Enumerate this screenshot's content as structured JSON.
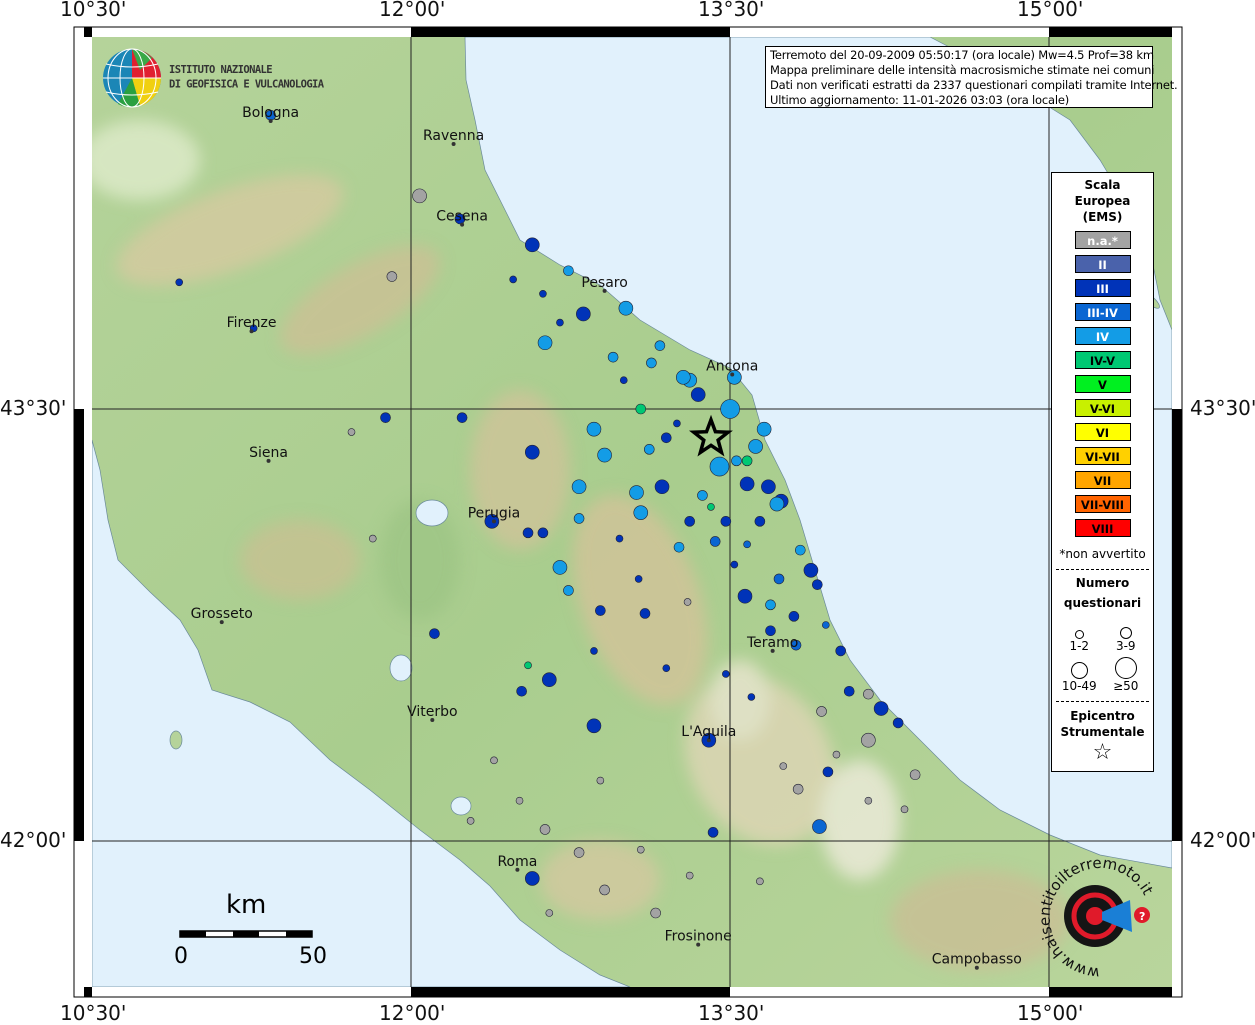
{
  "axes": {
    "lon_ticks": [
      "10°30'",
      "12°00'",
      "13°30'",
      "15°00'"
    ],
    "lat_ticks": [
      "43°30'",
      "42°00'"
    ]
  },
  "info": {
    "line1": "Terremoto del 20-09-2009 05:50:17 (ora locale) Mw=4.5 Prof=38 km",
    "line2": "Mappa preliminare delle intensità macrosismiche stimate nei comuni",
    "line3": "Dati non verificati estratti da 2337 questionari compilati tramite Internet.",
    "line4": "Ultimo aggiornamento: 11-01-2026 03:03 (ora locale)"
  },
  "logo": {
    "ingv_line1": "ISTITUTO NAZIONALE",
    "ingv_line2": "DI GEOFISICA E VULCANOLOGIA",
    "haisentito": "www.haisentitoilterremoto.it"
  },
  "legend": {
    "title": [
      "Scala",
      "Europea",
      "(EMS)"
    ],
    "items": [
      {
        "label": "n.a.*",
        "color": "#a3a3a3",
        "text": "#ffffff"
      },
      {
        "label": "II",
        "color": "#4a62ab",
        "text": "#ffffff"
      },
      {
        "label": "III",
        "color": "#0033b8",
        "text": "#ffffff"
      },
      {
        "label": "III-IV",
        "color": "#0a66d2",
        "text": "#ffffff"
      },
      {
        "label": "IV",
        "color": "#139ce6",
        "text": "#ffffff"
      },
      {
        "label": "IV-V",
        "color": "#00c873",
        "text": "#000000"
      },
      {
        "label": "V",
        "color": "#00f020",
        "text": "#000000"
      },
      {
        "label": "V-VI",
        "color": "#c8f000",
        "text": "#000000"
      },
      {
        "label": "VI",
        "color": "#ffff00",
        "text": "#000000"
      },
      {
        "label": "VI-VII",
        "color": "#ffd000",
        "text": "#000000"
      },
      {
        "label": "VII",
        "color": "#ffa500",
        "text": "#000000"
      },
      {
        "label": "VII-VIII",
        "color": "#ff6400",
        "text": "#000000"
      },
      {
        "label": "VIII",
        "color": "#ff0000",
        "text": "#000000"
      }
    ],
    "note": "*non avvertito",
    "count_title": [
      "Numero",
      "questionari"
    ],
    "count_classes": [
      "1-2",
      "3-9",
      "10-49",
      "≥50"
    ],
    "epicenter_title": [
      "Epicentro",
      "Strumentale"
    ]
  },
  "scale_bar": {
    "unit": "km",
    "start": "0",
    "end": "50"
  },
  "cities": [
    {
      "name": "Bologna",
      "lon": 11.34,
      "lat": 44.5
    },
    {
      "name": "Ravenna",
      "lon": 12.2,
      "lat": 44.42
    },
    {
      "name": "Cesena",
      "lon": 12.24,
      "lat": 44.14
    },
    {
      "name": "Pesaro",
      "lon": 12.91,
      "lat": 43.91
    },
    {
      "name": "Firenze",
      "lon": 11.25,
      "lat": 43.77
    },
    {
      "name": "Ancona",
      "lon": 13.51,
      "lat": 43.62
    },
    {
      "name": "Siena",
      "lon": 11.33,
      "lat": 43.32
    },
    {
      "name": "Perugia",
      "lon": 12.39,
      "lat": 43.11
    },
    {
      "name": "Grosseto",
      "lon": 11.11,
      "lat": 42.76
    },
    {
      "name": "Teramo",
      "lon": 13.7,
      "lat": 42.66
    },
    {
      "name": "Viterbo",
      "lon": 12.1,
      "lat": 42.42
    },
    {
      "name": "L'Aquila",
      "lon": 13.4,
      "lat": 42.35
    },
    {
      "name": "Roma",
      "lon": 12.5,
      "lat": 41.9
    },
    {
      "name": "Frosinone",
      "lon": 13.35,
      "lat": 41.64
    },
    {
      "name": "Campobasso",
      "lon": 14.66,
      "lat": 41.56
    }
  ],
  "epicenter": {
    "lon": 13.41,
    "lat": 43.4
  },
  "observations": [
    [
      13.5,
      43.5,
      "IV",
      4
    ],
    [
      13.45,
      43.3,
      "IV",
      4
    ],
    [
      13.31,
      43.6,
      "IV",
      3
    ],
    [
      13.35,
      43.55,
      "III",
      3
    ],
    [
      13.66,
      43.43,
      "IV",
      3
    ],
    [
      13.62,
      43.37,
      "IV",
      3
    ],
    [
      13.53,
      43.32,
      "IV",
      2
    ],
    [
      13.58,
      43.24,
      "III",
      3
    ],
    [
      13.68,
      43.23,
      "III",
      3
    ],
    [
      13.74,
      43.18,
      "III",
      3
    ],
    [
      13.72,
      43.17,
      "IV",
      3
    ],
    [
      13.64,
      43.11,
      "III",
      2
    ],
    [
      13.48,
      43.11,
      "III",
      2
    ],
    [
      13.31,
      43.11,
      "III",
      2
    ],
    [
      13.18,
      43.23,
      "III",
      3
    ],
    [
      13.08,
      43.14,
      "IV",
      3
    ],
    [
      13.06,
      43.21,
      "IV",
      3
    ],
    [
      12.91,
      43.34,
      "IV",
      3
    ],
    [
      12.86,
      43.43,
      "IV",
      3
    ],
    [
      12.79,
      43.23,
      "IV",
      3
    ],
    [
      12.79,
      43.12,
      "IV",
      2
    ],
    [
      12.63,
      43.73,
      "IV",
      3
    ],
    [
      12.81,
      43.83,
      "III",
      3
    ],
    [
      13.01,
      43.85,
      "IV",
      3
    ],
    [
      13.17,
      43.72,
      "IV",
      2
    ],
    [
      13.28,
      43.61,
      "IV",
      3
    ],
    [
      13.52,
      43.61,
      "IV",
      3
    ],
    [
      12.57,
      44.07,
      "III",
      3
    ],
    [
      12.74,
      43.98,
      "IV",
      2
    ],
    [
      12.23,
      44.16,
      "III",
      2
    ],
    [
      12.04,
      44.24,
      "na",
      3
    ],
    [
      11.88,
      43.47,
      "III",
      2
    ],
    [
      12.24,
      43.47,
      "III",
      2
    ],
    [
      12.57,
      43.35,
      "III",
      3
    ],
    [
      12.38,
      43.11,
      "III",
      3
    ],
    [
      12.55,
      43.07,
      "III",
      2
    ],
    [
      12.62,
      43.07,
      "III",
      2
    ],
    [
      12.7,
      42.95,
      "IV",
      3
    ],
    [
      13.1,
      42.79,
      "III",
      2
    ],
    [
      13.57,
      42.85,
      "III",
      3
    ],
    [
      13.69,
      42.82,
      "IV",
      2
    ],
    [
      13.88,
      42.94,
      "III",
      3
    ],
    [
      13.91,
      42.89,
      "III",
      2
    ],
    [
      13.73,
      42.91,
      "III-IV",
      2
    ],
    [
      13.8,
      42.78,
      "III",
      2
    ],
    [
      13.69,
      42.73,
      "III",
      2
    ],
    [
      13.81,
      42.68,
      "III-IV",
      2
    ],
    [
      14.02,
      42.66,
      "III",
      2
    ],
    [
      14.06,
      42.52,
      "III",
      2
    ],
    [
      14.21,
      42.46,
      "III",
      3
    ],
    [
      14.29,
      42.41,
      "III",
      2
    ],
    [
      14.15,
      42.35,
      "na",
      3
    ],
    [
      14.15,
      42.51,
      "na",
      2
    ],
    [
      13.93,
      42.45,
      "na",
      2
    ],
    [
      12.86,
      42.4,
      "III",
      3
    ],
    [
      12.65,
      42.56,
      "III",
      3
    ],
    [
      12.52,
      42.52,
      "III",
      2
    ],
    [
      12.11,
      42.72,
      "III",
      2
    ],
    [
      12.55,
      42.61,
      "IV-V",
      1
    ],
    [
      13.4,
      42.35,
      "III",
      3
    ],
    [
      12.57,
      41.87,
      "III",
      3
    ],
    [
      12.63,
      42.04,
      "na",
      2
    ],
    [
      12.79,
      41.96,
      "na",
      2
    ],
    [
      12.91,
      41.83,
      "na",
      2
    ],
    [
      13.15,
      41.75,
      "na",
      2
    ],
    [
      13.92,
      42.05,
      "III-IV",
      3
    ],
    [
      13.96,
      42.24,
      "III",
      2
    ],
    [
      14.37,
      42.23,
      "na",
      2
    ],
    [
      10.91,
      43.94,
      "III",
      1
    ],
    [
      11.26,
      43.78,
      "III",
      1
    ],
    [
      11.34,
      44.52,
      "III-IV",
      2
    ],
    [
      11.91,
      43.96,
      "na",
      2
    ],
    [
      13.08,
      43.5,
      "IV-V",
      2
    ],
    [
      13.58,
      43.32,
      "IV-V",
      2
    ],
    [
      13.41,
      43.16,
      "IV-V",
      1
    ],
    [
      12.74,
      42.87,
      "IV",
      2
    ],
    [
      12.89,
      42.8,
      "III",
      2
    ],
    [
      13.42,
      42.03,
      "III",
      2
    ],
    [
      13.3,
      42.83,
      "na",
      1
    ],
    [
      13.07,
      42.91,
      "III",
      1
    ],
    [
      13.52,
      42.96,
      "III",
      1
    ],
    [
      13.95,
      42.75,
      "III-IV",
      1
    ],
    [
      13.43,
      43.04,
      "III-IV",
      2
    ],
    [
      13.58,
      43.03,
      "III-IV",
      1
    ],
    [
      13.83,
      43.01,
      "IV",
      2
    ],
    [
      11.72,
      43.42,
      "na",
      1
    ],
    [
      11.82,
      43.05,
      "na",
      1
    ],
    [
      12.39,
      42.28,
      "na",
      1
    ],
    [
      12.28,
      42.07,
      "na",
      1
    ],
    [
      12.65,
      41.75,
      "na",
      1
    ],
    [
      13.31,
      41.88,
      "na",
      1
    ],
    [
      13.64,
      41.86,
      "na",
      1
    ],
    [
      13.82,
      42.18,
      "na",
      2
    ],
    [
      14.15,
      42.14,
      "na",
      1
    ],
    [
      14.32,
      42.11,
      "na",
      1
    ],
    [
      12.89,
      42.21,
      "na",
      1
    ],
    [
      13.08,
      41.97,
      "na",
      1
    ],
    [
      12.51,
      42.14,
      "na",
      1
    ],
    [
      13.2,
      43.4,
      "III",
      2
    ],
    [
      13.12,
      43.36,
      "IV",
      2
    ],
    [
      13.25,
      43.45,
      "III",
      1
    ],
    [
      13.0,
      43.6,
      "III",
      1
    ],
    [
      12.95,
      43.68,
      "IV",
      2
    ],
    [
      13.13,
      43.66,
      "IV",
      2
    ],
    [
      12.7,
      43.8,
      "III",
      1
    ],
    [
      12.62,
      43.9,
      "III",
      1
    ],
    [
      12.48,
      43.95,
      "III",
      1
    ],
    [
      13.37,
      43.2,
      "IV",
      2
    ],
    [
      13.26,
      43.02,
      "IV",
      2
    ],
    [
      12.98,
      43.05,
      "III",
      1
    ],
    [
      12.86,
      42.66,
      "III",
      1
    ],
    [
      13.2,
      42.6,
      "III",
      1
    ],
    [
      13.48,
      42.58,
      "III",
      1
    ],
    [
      13.6,
      42.5,
      "III",
      1
    ],
    [
      14.0,
      42.3,
      "na",
      1
    ],
    [
      13.75,
      42.26,
      "na",
      1
    ]
  ]
}
